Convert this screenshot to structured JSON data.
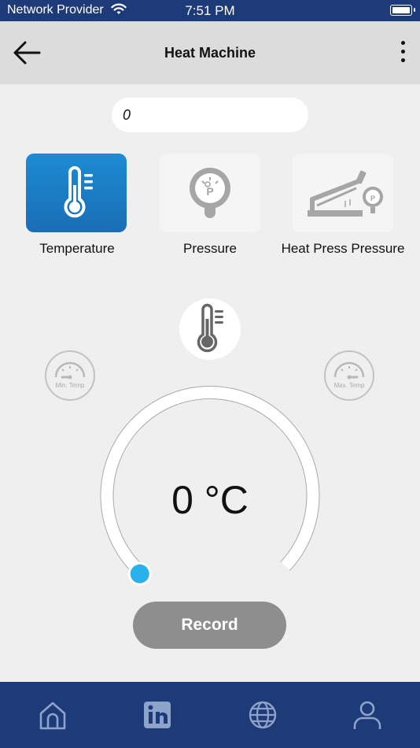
{
  "status_bar": {
    "carrier": "Network Provider",
    "time": "7:51 PM"
  },
  "header": {
    "title": "Heat Machine",
    "back_icon": "arrow-left-icon",
    "menu_icon": "more-vertical-icon"
  },
  "value_field": {
    "value": "0"
  },
  "modes": [
    {
      "label": "Temperature",
      "icon": "thermometer-icon",
      "selected": true
    },
    {
      "label": "Pressure",
      "icon": "pressure-gauge-icon",
      "selected": false
    },
    {
      "label": "Heat Press Pressure",
      "icon": "heat-press-icon",
      "selected": false
    }
  ],
  "gauge": {
    "min_label": "Min. Temp",
    "max_label": "Max. Temp",
    "reading": "0 °C",
    "level": 0
  },
  "record_button": {
    "label": "Record"
  },
  "tab_bar": [
    "home-icon",
    "linkedin-icon",
    "globe-icon",
    "user-icon"
  ],
  "colors": {
    "primary": "#1e3b79",
    "accent": "#1c86cc",
    "knob": "#2ab0ec",
    "record_button": "#8e8e8e"
  }
}
